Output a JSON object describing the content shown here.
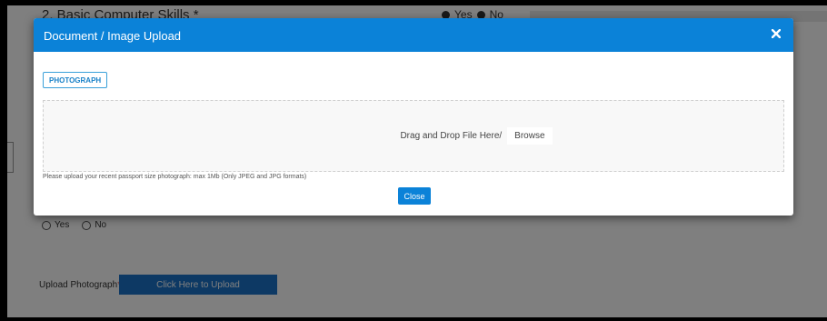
{
  "background_page": {
    "question_title": "2. Basic Computer Skills *",
    "top_radio": {
      "yes": "Yes",
      "no": "No"
    },
    "radio_row": {
      "yes": "Yes",
      "no": "No"
    },
    "upload_label": "Upload Photograph",
    "upload_required_mark": "*",
    "upload_button": "Click Here to Upload"
  },
  "modal": {
    "title": "Document / Image Upload",
    "close_icon": "close-x-icon",
    "tag_label": "PHOTOGRAPH",
    "dropzone_text": "Drag and Drop File Here/",
    "browse_label": "Browse",
    "help_text": "Please upload your recent passport size photograph: max 1Mb (Only JPEG and JPG formats)",
    "close_button": "Close"
  },
  "colors": {
    "header_blue": "#0b82d8",
    "button_blue": "#1a73c9",
    "tag_border": "#3aa0d9",
    "overlay": "rgba(0,0,0,0.5)"
  }
}
